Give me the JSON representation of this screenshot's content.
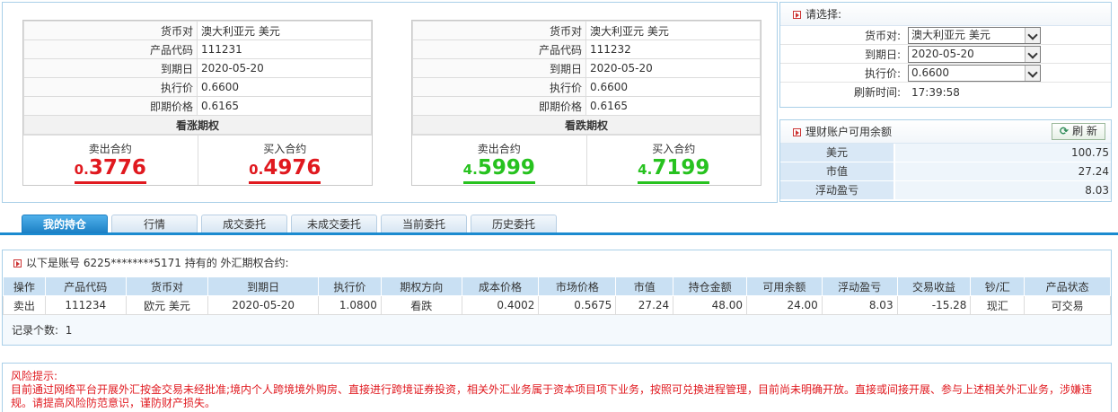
{
  "call_card": {
    "rows": [
      {
        "label": "货币对",
        "value": "澳大利亚元 美元"
      },
      {
        "label": "产品代码",
        "value": "111231"
      },
      {
        "label": "到期日",
        "value": "2020-05-20"
      },
      {
        "label": "执行价",
        "value": "0.6600"
      },
      {
        "label": "即期价格",
        "value": "0.6165"
      }
    ],
    "title": "看涨期权",
    "sell_label": "卖出合约",
    "sell_price_small": "0.",
    "sell_price_big": "3776",
    "buy_label": "买入合约",
    "buy_price_small": "0.",
    "buy_price_big": "4976",
    "price_color": "#e0191f"
  },
  "put_card": {
    "rows": [
      {
        "label": "货币对",
        "value": "澳大利亚元 美元"
      },
      {
        "label": "产品代码",
        "value": "111232"
      },
      {
        "label": "到期日",
        "value": "2020-05-20"
      },
      {
        "label": "执行价",
        "value": "0.6600"
      },
      {
        "label": "即期价格",
        "value": "0.6165"
      }
    ],
    "title": "看跌期权",
    "sell_label": "卖出合约",
    "sell_price_small": "4.",
    "sell_price_big": "5999",
    "buy_label": "买入合约",
    "buy_price_small": "4.",
    "buy_price_big": "7199",
    "price_color": "#27c21f"
  },
  "selector": {
    "title": "请选择:",
    "pair_label": "货币对:",
    "pair_value": "澳大利亚元 美元",
    "expiry_label": "到期日:",
    "expiry_value": "2020-05-20",
    "strike_label": "执行价:",
    "strike_value": "0.6600",
    "refresh_time_label": "刷新时间:",
    "refresh_time_value": "17:39:58"
  },
  "balance": {
    "title": "理财账户可用余额",
    "refresh_label": "刷 新",
    "rows": [
      {
        "label": "美元",
        "value": "100.75"
      },
      {
        "label": "市值",
        "value": "27.24"
      },
      {
        "label": "浮动盈亏",
        "value": "8.03"
      }
    ]
  },
  "tabs": [
    "我的持仓",
    "行情",
    "成交委托",
    "未成交委托",
    "当前委托",
    "历史委托"
  ],
  "active_tab": "我的持仓",
  "holdings": {
    "header": "以下是账号 6225********5171 持有的 外汇期权合约:",
    "columns": [
      "操作",
      "产品代码",
      "货币对",
      "到期日",
      "执行价",
      "期权方向",
      "成本价格",
      "市场价格",
      "市值",
      "持仓金额",
      "可用余额",
      "浮动盈亏",
      "交易收益",
      "钞/汇",
      "产品状态"
    ],
    "rows": [
      {
        "action": "卖出",
        "code": "111234",
        "pair": "欧元 美元",
        "expiry": "2020-05-20",
        "strike": "1.0800",
        "direction": "看跌",
        "cost": "0.4002",
        "market_price": "0.5675",
        "market_value": "27.24",
        "position_amount": "48.00",
        "available": "24.00",
        "floating_pl": "8.03",
        "trade_pl": "-15.28",
        "cash_type": "现汇",
        "status": "可交易"
      }
    ],
    "record_label": "记录个数:",
    "record_count": "1"
  },
  "risk": {
    "title": "风险提示:",
    "text": "目前通过网络平台开展外汇按金交易未经批准;境内个人跨境境外购房、直接进行跨境证券投资，相关外汇业务属于资本项目项下业务，按照可兑换进程管理，目前尚未明确开放。直接或间接开展、参与上述相关外汇业务，涉嫌违规。请提高风险防范意识，谨防财产损失。"
  }
}
